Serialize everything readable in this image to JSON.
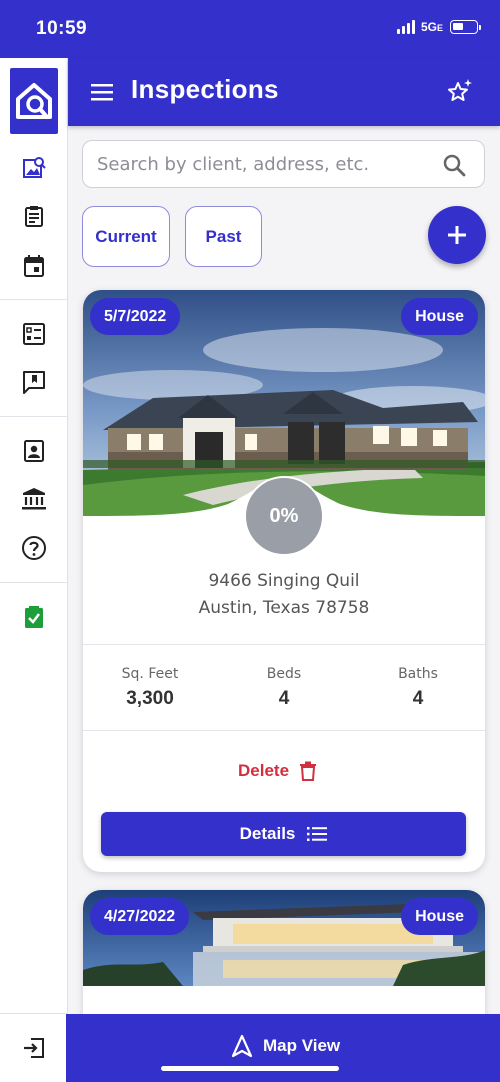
{
  "status_bar": {
    "time": "10:59",
    "network": "5G",
    "network_suffix": "E"
  },
  "header": {
    "title": "Inspections"
  },
  "search": {
    "placeholder": "Search by client, address, etc."
  },
  "filters": {
    "current": "Current",
    "past": "Past"
  },
  "inspections": [
    {
      "date": "5/7/2022",
      "type": "House",
      "progress": "0%",
      "address_line1": "9466 Singing Quil",
      "address_line2": "Austin, Texas 78758",
      "stats": [
        {
          "label": "Sq. Feet",
          "value": "3,300"
        },
        {
          "label": "Beds",
          "value": "4"
        },
        {
          "label": "Baths",
          "value": "4"
        }
      ],
      "delete_label": "Delete",
      "details_label": "Details"
    },
    {
      "date": "4/27/2022",
      "type": "House"
    }
  ],
  "bottom": {
    "map_label": "Map View"
  },
  "colors": {
    "primary": "#3430cc",
    "danger": "#d32f3f",
    "progress_gray": "#9a9ea6"
  },
  "sidebar_icons": [
    "photos-icon",
    "clipboard-icon",
    "calendar-icon",
    "checklist-icon",
    "bookmark-chat-icon",
    "contact-icon",
    "bank-icon",
    "help-icon",
    "approved-icon",
    "logout-icon"
  ]
}
